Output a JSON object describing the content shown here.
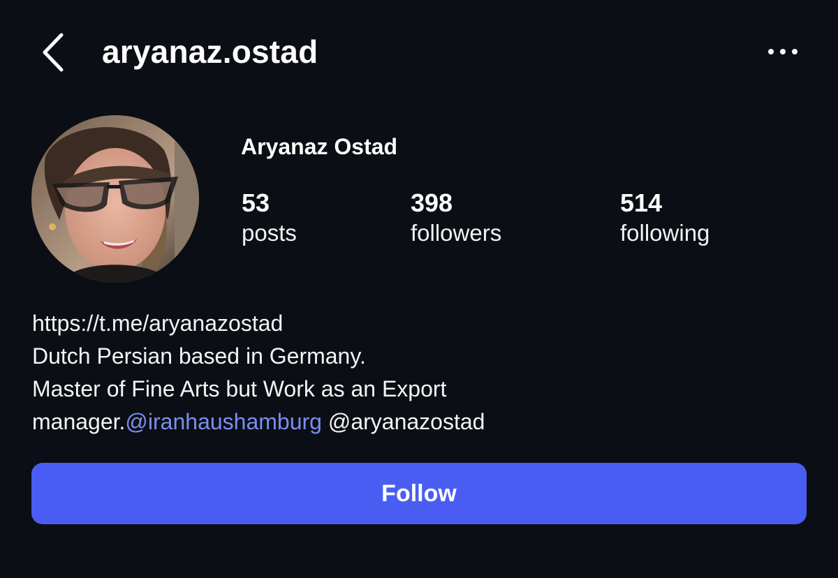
{
  "header": {
    "username": "aryanaz.ostad",
    "back_icon": "chevron-left-icon",
    "more_icon": "more-horizontal-icon"
  },
  "profile": {
    "display_name": "Aryanaz Ostad",
    "stats": {
      "posts": {
        "count": "53",
        "label": "posts"
      },
      "followers": {
        "count": "398",
        "label": "followers"
      },
      "following": {
        "count": "514",
        "label": "following"
      }
    }
  },
  "bio": {
    "link": "https://t.me/aryanazostad",
    "line1": "Dutch Persian based in Germany.",
    "line2": "Master of Fine Arts but Work as an Export",
    "line3_prefix": "manager.",
    "mention1": "@iranhaushamburg",
    "mention2": "@aryanazostad"
  },
  "actions": {
    "follow_label": "Follow"
  },
  "colors": {
    "background": "#0b0e14",
    "accent": "#4a5df2",
    "mention": "#7a8ff0"
  }
}
